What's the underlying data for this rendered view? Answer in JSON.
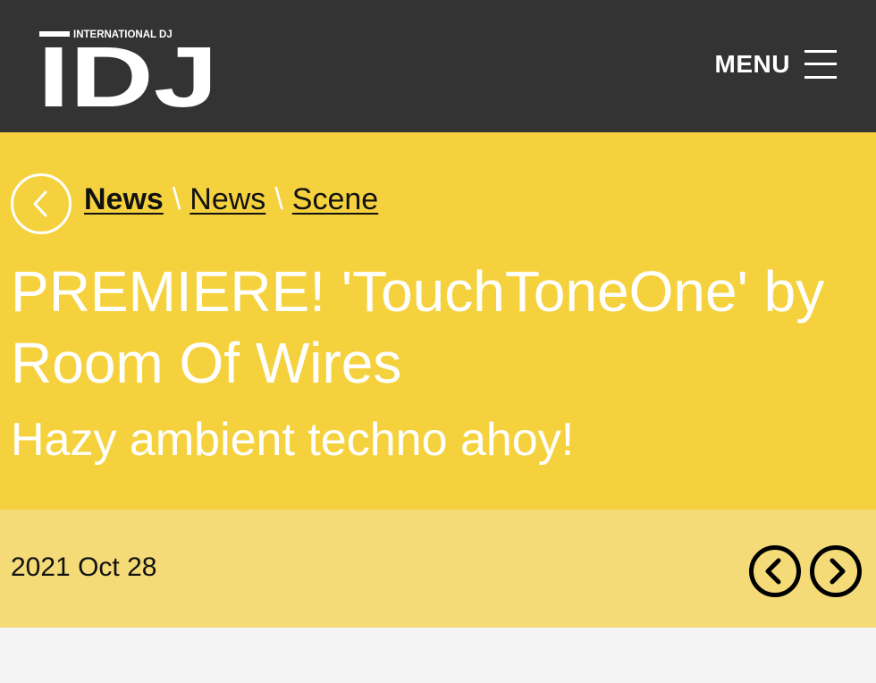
{
  "header": {
    "logo_top_text": "INTERNATIONAL DJ",
    "logo_main_text": "IDJ",
    "menu_label": "MENU"
  },
  "breadcrumb": {
    "items": [
      {
        "label": "News"
      },
      {
        "label": "News"
      },
      {
        "label": "Scene"
      }
    ],
    "separator": "\\"
  },
  "article": {
    "title": "PREMIERE! 'TouchToneOne' by Room Of Wires",
    "subtitle": "Hazy ambient techno ahoy!",
    "date": "2021 Oct 28"
  },
  "icons": {
    "back": "chevron-left-icon",
    "menu": "hamburger-icon",
    "prev": "chevron-left-circle-icon",
    "next": "chevron-right-circle-icon"
  },
  "colors": {
    "header_bg": "#333333",
    "hero_bg": "#f5d23d",
    "datebar_bg": "#f4db78",
    "page_bg": "#f4f4f4"
  }
}
